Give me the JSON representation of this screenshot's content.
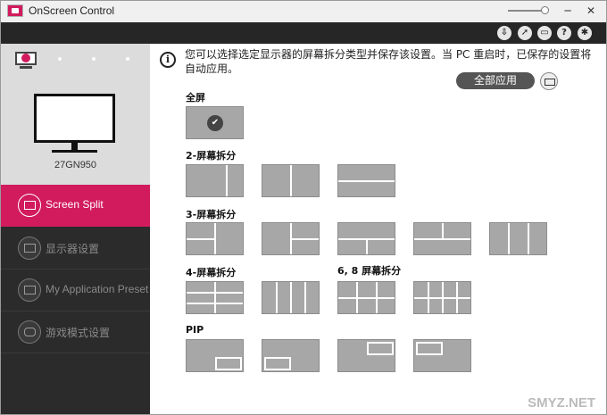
{
  "window": {
    "title": "OnScreen Control"
  },
  "sidebar": {
    "monitor_name": "27GN950",
    "items": [
      {
        "label": "Screen Split"
      },
      {
        "label": "显示器设置"
      },
      {
        "label": "My Application Preset"
      },
      {
        "label": "游戏模式设置"
      }
    ]
  },
  "main": {
    "info_text": "您可以选择选定显示器的屏幕拆分类型并保存该设置。当 PC 重启时，已保存的设置将自动应用。",
    "apply_all_label": "全部应用",
    "sections": {
      "full": "全屏",
      "split2": "2-屏幕拆分",
      "split3": "3-屏幕拆分",
      "split4": "4-屏幕拆分",
      "split68": "6, 8 屏幕拆分",
      "pip": "PIP"
    }
  },
  "watermark": "SMYZ.NET",
  "colors": {
    "accent": "#d11b5d",
    "sidebar": "#2b2b2b",
    "tile": "#a7a7a7"
  }
}
